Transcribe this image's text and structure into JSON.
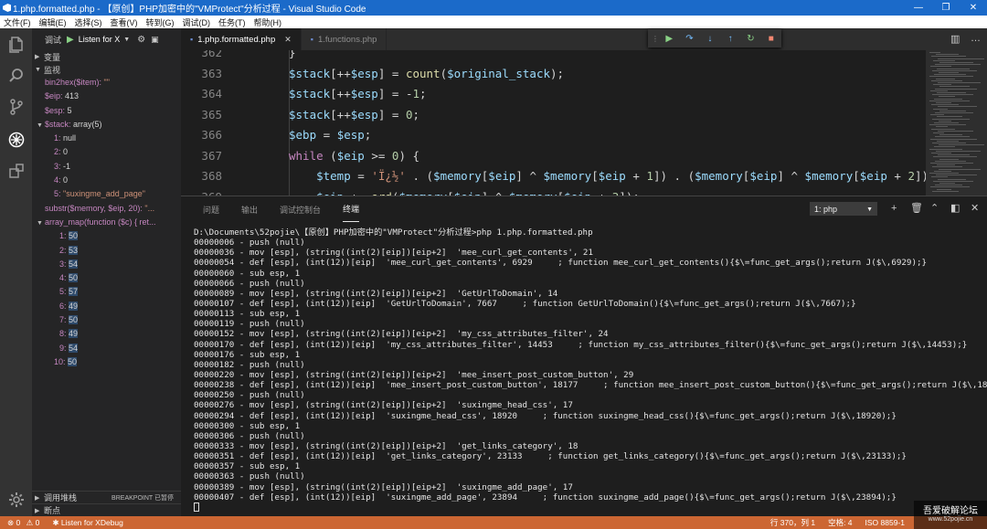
{
  "window": {
    "title": "1.php.formatted.php - 【原创】PHP加密中的\"VMProtect\"分析过程 - Visual Studio Code",
    "controls": [
      "—",
      "❐",
      "✕"
    ]
  },
  "menu": [
    "文件(F)",
    "编辑(E)",
    "选择(S)",
    "查看(V)",
    "转到(G)",
    "调试(D)",
    "任务(T)",
    "帮助(H)"
  ],
  "activity_icons": [
    "files-icon",
    "search-icon",
    "source-control-icon",
    "debug-icon",
    "extensions-icon",
    "settings-gear-icon"
  ],
  "sidebar": {
    "debug_label": "调试",
    "debug_config": "Listen for X",
    "sections": {
      "variables": "变量",
      "watch": "监视",
      "call_stack": "调用堆栈",
      "breakpoints": "断点",
      "breakpoint_badge": "BREAKPOINT 已暂停"
    },
    "watch_top": [
      {
        "k": "bin2hex($item): ",
        "v": "\"\"",
        "vclass": "s"
      },
      {
        "k": "$eip: ",
        "v": "413",
        "vclass": "v"
      },
      {
        "k": "$esp: ",
        "v": "5",
        "vclass": "v"
      }
    ],
    "stack_head": {
      "k": "$stack: ",
      "v": "array(5)"
    },
    "stack_items": [
      {
        "k": "1: ",
        "v": "null"
      },
      {
        "k": "2: ",
        "v": "0"
      },
      {
        "k": "3: ",
        "v": "-1"
      },
      {
        "k": "4: ",
        "v": "0"
      },
      {
        "k": "5: ",
        "v": "\"suxingme_add_page\""
      }
    ],
    "substr_row": {
      "k": "substr($memory, $eip, 20): ",
      "v": "\"..."
    },
    "array_map_row": {
      "k": "array_map(function ($c) { ret..."
    },
    "map_items": [
      {
        "k": "1: ",
        "v": "50"
      },
      {
        "k": "2: ",
        "v": "53"
      },
      {
        "k": "3: ",
        "v": "54"
      },
      {
        "k": "4: ",
        "v": "50"
      },
      {
        "k": "5: ",
        "v": "57"
      },
      {
        "k": "6: ",
        "v": "49"
      },
      {
        "k": "7: ",
        "v": "50"
      },
      {
        "k": "8: ",
        "v": "49"
      },
      {
        "k": "9: ",
        "v": "54"
      },
      {
        "k": "10: ",
        "v": "50"
      }
    ]
  },
  "tabs": [
    {
      "label": "1.php.formatted.php",
      "active": true
    },
    {
      "label": "1.functions.php",
      "active": false
    }
  ],
  "debug_controls": [
    "continue",
    "step-over",
    "step-into",
    "step-out",
    "restart",
    "stop"
  ],
  "code": {
    "lines": [
      {
        "n": "362",
        "html": "}"
      },
      {
        "n": "363",
        "html": "<span class='var'>$stack</span>[++<span class='var'>$esp</span>] = <span class='fn'>count</span>(<span class='var'>$original_stack</span>);"
      },
      {
        "n": "364",
        "html": "<span class='var'>$stack</span>[++<span class='var'>$esp</span>] = -<span class='num'>1</span>;"
      },
      {
        "n": "365",
        "html": "<span class='var'>$stack</span>[++<span class='var'>$esp</span>] = <span class='num'>0</span>;"
      },
      {
        "n": "366",
        "html": "<span class='var'>$ebp</span> = <span class='var'>$esp</span>;"
      },
      {
        "n": "367",
        "html": "<span class='kw'>while</span> (<span class='var'>$eip</span> &gt;= <span class='num'>0</span>) {"
      },
      {
        "n": "368",
        "html": "    <span class='var'>$temp</span> = <span class='str'>'Ï¿½'</span> . (<span class='var'>$memory</span>[<span class='var'>$eip</span>] ^ <span class='var'>$memory</span>[<span class='var'>$eip</span> + <span class='num'>1</span>]) . (<span class='var'>$memory</span>[<span class='var'>$eip</span>] ^ <span class='var'>$memory</span>[<span class='var'>$eip</span> + <span class='num'>2</span>]) . (<span class='var'>$me</span>"
      },
      {
        "n": "369",
        "html": "    <span class='var'>$eip</span> += <span class='fn'>ord</span>(<span class='var'>$memory</span>[<span class='var'>$eip</span>] ^ <span class='var'>$memory</span>[<span class='var'>$eip</span> + <span class='num'>3</span>]);"
      }
    ]
  },
  "panel": {
    "tabs": [
      "问题",
      "输出",
      "调试控制台",
      "终端"
    ],
    "active_tab": "终端",
    "terminal_select": "1: php",
    "terminal_lines": [
      "D:\\Documents\\52pojie\\【原创】PHP加密中的\"VMProtect\"分析过程>php 1.php.formatted.php",
      "00000006 - push (null)",
      "00000036 - mov [esp], (string((int(2)[eip])[eip+2]  'mee_curl_get_contents', 21",
      "00000054 - def [esp], (int(12))[eip]  'mee_curl_get_contents', 6929     ; function mee_curl_get_contents(){$\\=func_get_args();return J($\\,6929);}",
      "00000060 - sub esp, 1",
      "00000066 - push (null)",
      "00000089 - mov [esp], (string((int(2)[eip])[eip+2]  'GetUrlToDomain', 14",
      "00000107 - def [esp], (int(12))[eip]  'GetUrlToDomain', 7667     ; function GetUrlToDomain(){$\\=func_get_args();return J($\\,7667);}",
      "00000113 - sub esp, 1",
      "00000119 - push (null)",
      "00000152 - mov [esp], (string((int(2)[eip])[eip+2]  'my_css_attributes_filter', 24",
      "00000170 - def [esp], (int(12))[eip]  'my_css_attributes_filter', 14453     ; function my_css_attributes_filter(){$\\=func_get_args();return J($\\,14453);}",
      "00000176 - sub esp, 1",
      "00000182 - push (null)",
      "00000220 - mov [esp], (string((int(2)[eip])[eip+2]  'mee_insert_post_custom_button', 29",
      "00000238 - def [esp], (int(12))[eip]  'mee_insert_post_custom_button', 18177     ; function mee_insert_post_custom_button(){$\\=func_get_args();return J($\\,18177);}",
      "00000250 - push (null)",
      "00000276 - mov [esp], (string((int(2)[eip])[eip+2]  'suxingme_head_css', 17",
      "00000294 - def [esp], (int(12))[eip]  'suxingme_head_css', 18920     ; function suxingme_head_css(){$\\=func_get_args();return J($\\,18920);}",
      "00000300 - sub esp, 1",
      "00000306 - push (null)",
      "00000333 - mov [esp], (string((int(2)[eip])[eip+2]  'get_links_category', 18",
      "00000351 - def [esp], (int(12))[eip]  'get_links_category', 23133     ; function get_links_category(){$\\=func_get_args();return J($\\,23133);}",
      "00000357 - sub esp, 1",
      "00000363 - push (null)",
      "00000389 - mov [esp], (string((int(2)[eip])[eip+2]  'suxingme_add_page', 17",
      "00000407 - def [esp], (int(12))[eip]  'suxingme_add_page', 23894     ; function suxingme_add_page(){$\\=func_get_args();return J($\\,23894);}"
    ]
  },
  "statusbar": {
    "errors": "0",
    "warnings": "0",
    "debug_label": "Listen for XDebug",
    "position": "行 370，列 1",
    "spaces": "空格: 4",
    "encoding": "ISO 8859-1"
  },
  "watermark": {
    "line1": "吾爱破解论坛",
    "line2": "www.52pojie.cn"
  },
  "colors": {
    "titlebar": "#1b6ac9",
    "statusbar": "#cc6633",
    "editor_bg": "#1e1e1e",
    "sidebar_bg": "#252526"
  }
}
